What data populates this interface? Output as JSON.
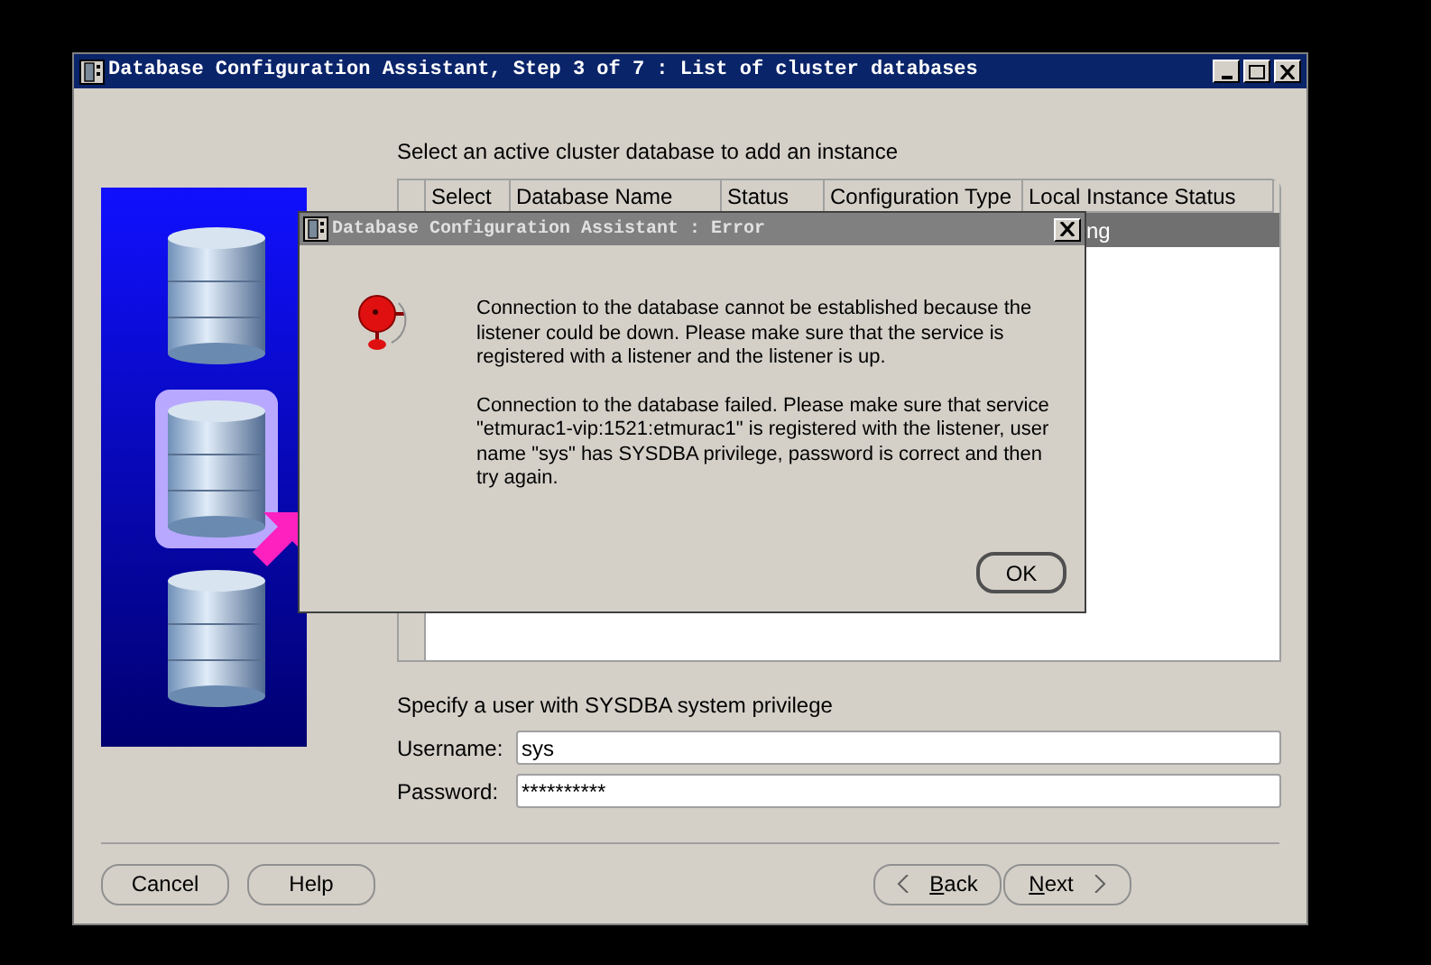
{
  "window": {
    "title": "Database Configuration Assistant, Step 3 of 7 : List of cluster databases"
  },
  "instruction": "Select an active cluster database to add an instance",
  "table": {
    "columns": [
      "Select",
      "Database Name",
      "Status",
      "Configuration Type",
      "Local Instance Status"
    ],
    "rows": [
      {
        "selected": true,
        "local_instance_status": "ng"
      }
    ]
  },
  "credentials": {
    "label": "Specify a user with SYSDBA system privilege",
    "fields": [
      {
        "label": "Username:",
        "value": "sys"
      },
      {
        "label": "Password:",
        "value": "**********"
      }
    ]
  },
  "buttons_left": [
    "Cancel",
    "Help"
  ],
  "nav_buttons": [
    {
      "label": "Back",
      "kind": "back"
    },
    {
      "label": "Next",
      "kind": "next"
    }
  ],
  "error_dialog": {
    "title": "Database Configuration Assistant : Error",
    "paragraphs": [
      "Connection to the database cannot be established because the listener could be down. Please make sure that the service is registered with a listener and the listener is up.",
      "Connection to the database failed. Please make sure that service \"etmurac1-vip:1521:etmurac1\" is registered with the listener, user name \"sys\" has SYSDBA privilege, password is correct and then try again."
    ],
    "button": "OK"
  }
}
